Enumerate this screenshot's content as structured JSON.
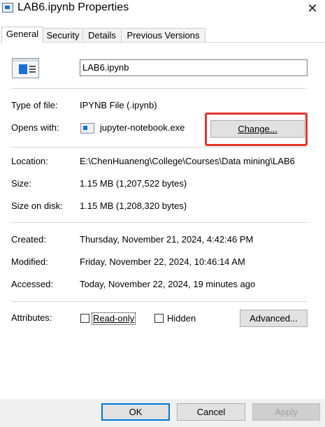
{
  "window": {
    "title": "LAB6.ipynb Properties",
    "close": "✕"
  },
  "tabs": [
    {
      "label": "General"
    },
    {
      "label": "Security"
    },
    {
      "label": "Details"
    },
    {
      "label": "Previous Versions"
    }
  ],
  "file": {
    "name": "LAB6.ipynb"
  },
  "type_section": {
    "type_label": "Type of file:",
    "type_value": "IPYNB File (.ipynb)",
    "opens_label": "Opens with:",
    "opens_value": "jupyter-notebook.exe",
    "change_button": "Change..."
  },
  "location_section": {
    "location_label": "Location:",
    "location_value": "E:\\ChenHuaneng\\College\\Courses\\Data mining\\LAB6",
    "size_label": "Size:",
    "size_value": "1.15 MB (1,207,522 bytes)",
    "size_on_disk_label": "Size on disk:",
    "size_on_disk_value": "1.15 MB (1,208,320 bytes)"
  },
  "dates_section": {
    "created_label": "Created:",
    "created_value": "Thursday, November 21, 2024, 4:42:46 PM",
    "modified_label": "Modified:",
    "modified_value": "Friday, November 22, 2024, 10:46:14 AM",
    "accessed_label": "Accessed:",
    "accessed_value": "Today, November 22, 2024, 19 minutes ago"
  },
  "attributes": {
    "label": "Attributes:",
    "readonly": "Read-only",
    "hidden": "Hidden",
    "advanced_button": "Advanced..."
  },
  "footer": {
    "ok": "OK",
    "cancel": "Cancel",
    "apply": "Apply"
  },
  "colors": {
    "highlight": "#e0352b",
    "accent": "#0078d7"
  }
}
